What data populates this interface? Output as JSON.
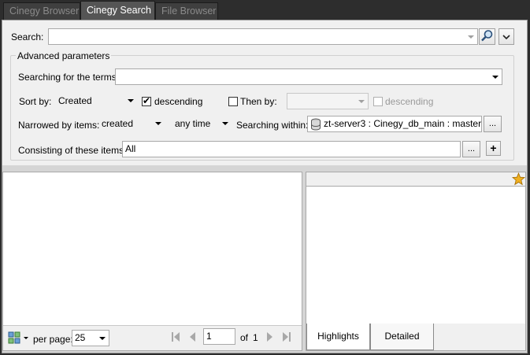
{
  "tabs": [
    {
      "label": "Cinegy Browser",
      "active": false
    },
    {
      "label": "Cinegy Search",
      "active": true
    },
    {
      "label": "File Browser",
      "active": false
    }
  ],
  "search": {
    "label": "Search:",
    "value": ""
  },
  "advanced": {
    "title": "Advanced parameters",
    "terms_label": "Searching for the terms:",
    "terms_value": "",
    "sort_label": "Sort by:",
    "sort_value": "Created",
    "descending_label": "descending",
    "descending_checked": true,
    "then_by_label": "Then by:",
    "then_by_checked": false,
    "then_by_value": "",
    "descending2_label": "descending",
    "descending2_checked": false,
    "narrowed_label": "Narrowed by items:",
    "narrowed_value": "created",
    "time_value": "any time",
    "within_label": "Searching within:",
    "within_value": "zt-server3 : Cinegy_db_main : master",
    "browse_label": "...",
    "consisting_label": "Consisting of these items:",
    "consisting_value": "All",
    "add_label": "+"
  },
  "pager": {
    "per_page_label": "per page:",
    "per_page_value": "25",
    "page_value": "1",
    "of_label": "of",
    "total_pages": "1"
  },
  "details": {
    "tabs": [
      "Highlights",
      "Detailed"
    ]
  },
  "colors": {
    "accent_star": "#f0b020",
    "tab_active": "#555555",
    "panel": "#f0f0f0"
  }
}
